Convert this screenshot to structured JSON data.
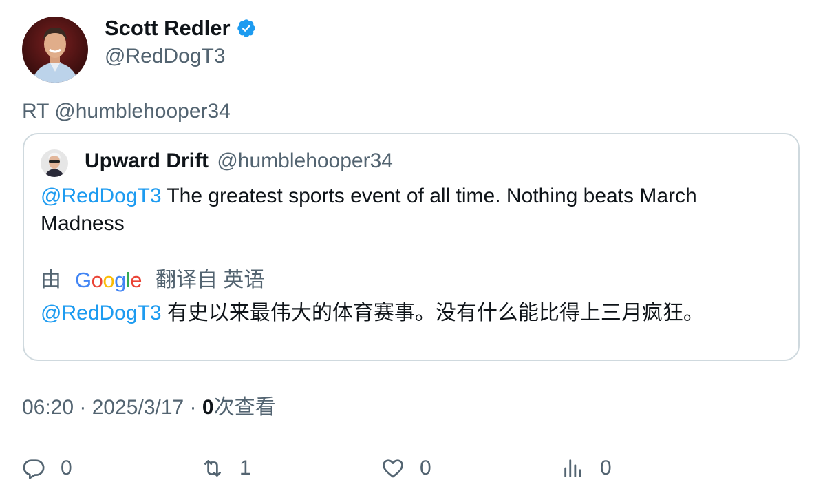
{
  "author": {
    "name": "Scott Redler",
    "handle": "@RedDogT3"
  },
  "retweet_line": "RT @humblehooper34",
  "quoted": {
    "name": "Upward Drift",
    "handle": "@humblehooper34",
    "mention": "@RedDogT3",
    "text": " The greatest sports event of all time. Nothing beats March Madness",
    "translate_prefix": "由",
    "translate_brand": [
      "G",
      "o",
      "o",
      "g",
      "l",
      "e"
    ],
    "translate_suffix": "翻译自 英语",
    "translated_mention": "@RedDogT3",
    "translated_text": " 有史以来最伟大的体育赛事。没有什么能比得上三月疯狂。"
  },
  "meta": {
    "time": "06:20",
    "sep": " · ",
    "date": "2025/3/17",
    "views_count": "0",
    "views_label": "次查看"
  },
  "actions": {
    "replies": "0",
    "retweets": "1",
    "likes": "0",
    "views": "0"
  },
  "colors": {
    "accent": "#1d9bf0",
    "secondary_text": "#536471",
    "border": "#cfd9de",
    "google_blue": "#4285f4",
    "google_red": "#ea4335",
    "google_yellow": "#fbbc05",
    "google_green": "#34a853"
  },
  "icons": [
    "verified-badge-icon",
    "reply-icon",
    "retweet-icon",
    "like-icon",
    "views-icon"
  ]
}
